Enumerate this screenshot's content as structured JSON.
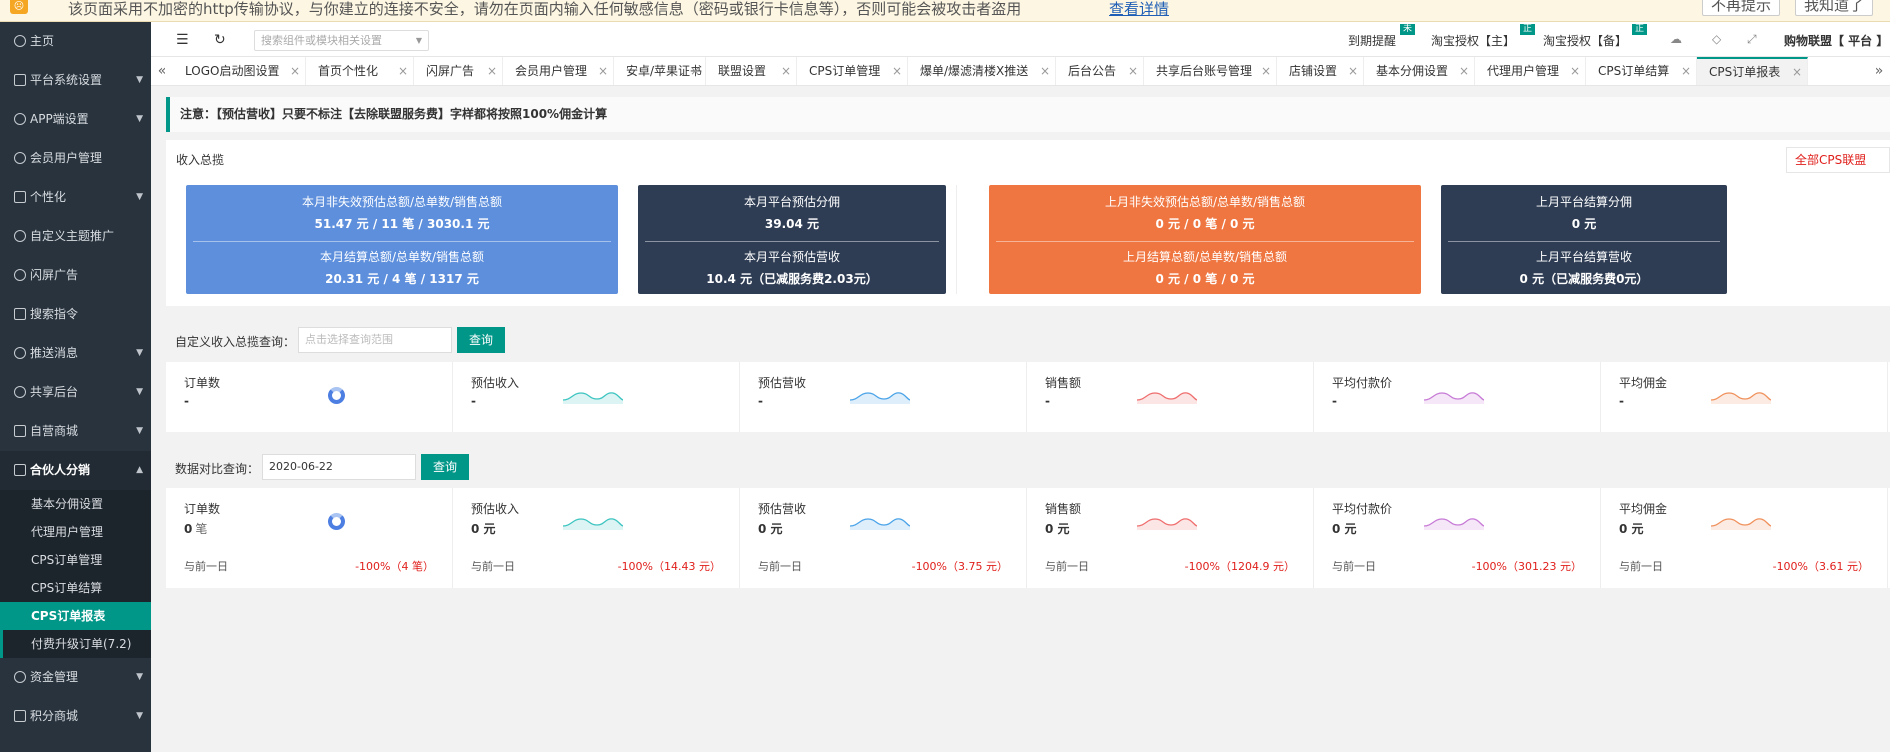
{
  "warning": {
    "text": "该页面采用不加密的http传输协议，与你建立的连接不安全，请勿在页面内输入任何敏感信息（密码或银行卡信息等），否则可能会被攻击者盗用",
    "link": "查看详情",
    "btn_no": "不再提示",
    "btn_ok": "我知道了"
  },
  "sidebar": {
    "items": [
      {
        "label": "主页",
        "caret": ""
      },
      {
        "label": "平台系统设置",
        "caret": "▼"
      },
      {
        "label": "APP端设置",
        "caret": "▼"
      },
      {
        "label": "会员用户管理",
        "caret": ""
      },
      {
        "label": "个性化",
        "caret": "▼"
      },
      {
        "label": "自定义主题推广",
        "caret": ""
      },
      {
        "label": "闪屏广告",
        "caret": ""
      },
      {
        "label": "搜索指令",
        "caret": ""
      },
      {
        "label": "推送消息",
        "caret": "▼"
      },
      {
        "label": "共享后台",
        "caret": "▼"
      },
      {
        "label": "自营商城",
        "caret": "▼"
      }
    ],
    "open": {
      "label": "合伙人分销",
      "caret": "▲"
    },
    "sub": [
      "基本分佣设置",
      "代理用户管理",
      "CPS订单管理",
      "CPS订单结算",
      "CPS订单报表",
      "付费升级订单(7.2)"
    ],
    "after": [
      {
        "label": "资金管理",
        "caret": "▼"
      },
      {
        "label": "积分商城",
        "caret": "▼"
      }
    ]
  },
  "header": {
    "search_placeholder": "搜索组件或模块相关设置",
    "expire": "到期提醒",
    "badge_expire": "未",
    "tb_main": "淘宝授权【主】",
    "badge_main": "正",
    "tb_backup": "淘宝授权【备】",
    "badge_backup": "正",
    "alliance": "购物联盟【 平台 】"
  },
  "tabs": [
    "LOGO启动图设置",
    "首页个性化",
    "闪屏广告",
    "会员用户管理",
    "安卓/苹果证书",
    "联盟设置",
    "CPS订单管理",
    "爆单/爆滤清楼X推送",
    "后台公告",
    "共享后台账号管理",
    "店铺设置",
    "基本分佣设置",
    "代理用户管理",
    "CPS订单结算",
    "CPS订单报表"
  ],
  "notice": "注意：【预估营收】只要不标注【去除联盟服务费】字样都将按照100%佣金计算",
  "summary": {
    "title": "收入总揽",
    "select": "全部CPS联盟",
    "cards": [
      {
        "l1": "本月非失效预估总额/总单数/销售总额",
        "v1": "51.47 元 / 11 笔 / 3030.1 元",
        "l2": "本月结算总额/总单数/销售总额",
        "v2": "20.31 元 / 4 笔 / 1317 元"
      },
      {
        "l1": "本月平台预估分佣",
        "v1": "39.04 元",
        "l2": "本月平台预估营收",
        "v2": "10.4 元（已减服务费2.03元）"
      },
      {
        "l1": "上月非失效预估总额/总单数/销售总额",
        "v1": "0 元 / 0 笔 / 0 元",
        "l2": "上月结算总额/总单数/销售总额",
        "v2": "0 元 / 0 笔 / 0 元"
      },
      {
        "l1": "上月平台结算分佣",
        "v1": "0 元",
        "l2": "上月平台结算营收",
        "v2": "0 元（已减服务费0元）"
      }
    ]
  },
  "custom_query": {
    "label": "自定义收入总揽查询：",
    "placeholder": "点击选择查询范围",
    "button": "查询"
  },
  "stats1": [
    {
      "label": "订单数",
      "value": "-"
    },
    {
      "label": "预估收入",
      "value": "-"
    },
    {
      "label": "预估营收",
      "value": "-"
    },
    {
      "label": "销售额",
      "value": "-"
    },
    {
      "label": "平均付款价",
      "value": "-"
    },
    {
      "label": "平均佣金",
      "value": "-"
    }
  ],
  "compare_query": {
    "label": "数据对比查询：",
    "date": "2020-06-22",
    "button": "查询"
  },
  "stats2": [
    {
      "label": "订单数",
      "value": "0",
      "unit": "笔",
      "cmp": "与前一日",
      "pct": "-100%（4 笔）"
    },
    {
      "label": "预估收入",
      "value": "0 元",
      "unit": "",
      "cmp": "与前一日",
      "pct": "-100%（14.43 元）"
    },
    {
      "label": "预估营收",
      "value": "0 元",
      "unit": "",
      "cmp": "与前一日",
      "pct": "-100%（3.75 元）"
    },
    {
      "label": "销售额",
      "value": "0 元",
      "unit": "",
      "cmp": "与前一日",
      "pct": "-100%（1204.9 元）"
    },
    {
      "label": "平均付款价",
      "value": "0 元",
      "unit": "",
      "cmp": "与前一日",
      "pct": "-100%（301.23 元）"
    },
    {
      "label": "平均佣金",
      "value": "0 元",
      "unit": "",
      "cmp": "与前一日",
      "pct": "-100%（3.61 元）"
    }
  ],
  "sparkline_colors": [
    "#4d7ee2",
    "#3cc4c0",
    "#4aa3e8",
    "#ef6e6e",
    "#c77ad6",
    "#f0915c"
  ],
  "colors": {
    "accent": "#009688",
    "sidebar": "#28333e",
    "card_blue": "#5d8fdc",
    "card_dark": "#2e3d54",
    "card_orange": "#ef7640",
    "alert_red": "#e0201c"
  }
}
